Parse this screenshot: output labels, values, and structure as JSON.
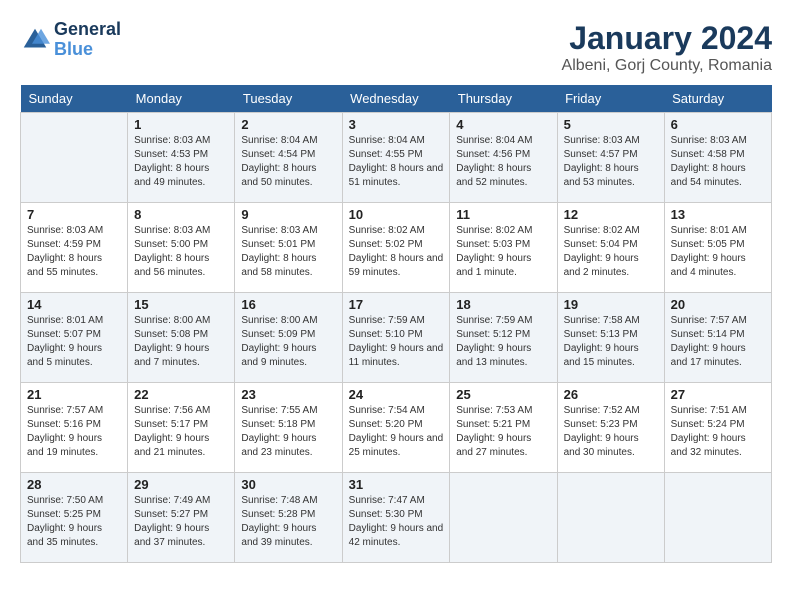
{
  "logo": {
    "line1": "General",
    "line2": "Blue"
  },
  "title": "January 2024",
  "subtitle": "Albeni, Gorj County, Romania",
  "weekdays": [
    "Sunday",
    "Monday",
    "Tuesday",
    "Wednesday",
    "Thursday",
    "Friday",
    "Saturday"
  ],
  "weeks": [
    [
      {
        "day": "",
        "sunrise": "",
        "sunset": "",
        "daylight": ""
      },
      {
        "day": "1",
        "sunrise": "Sunrise: 8:03 AM",
        "sunset": "Sunset: 4:53 PM",
        "daylight": "Daylight: 8 hours and 49 minutes."
      },
      {
        "day": "2",
        "sunrise": "Sunrise: 8:04 AM",
        "sunset": "Sunset: 4:54 PM",
        "daylight": "Daylight: 8 hours and 50 minutes."
      },
      {
        "day": "3",
        "sunrise": "Sunrise: 8:04 AM",
        "sunset": "Sunset: 4:55 PM",
        "daylight": "Daylight: 8 hours and 51 minutes."
      },
      {
        "day": "4",
        "sunrise": "Sunrise: 8:04 AM",
        "sunset": "Sunset: 4:56 PM",
        "daylight": "Daylight: 8 hours and 52 minutes."
      },
      {
        "day": "5",
        "sunrise": "Sunrise: 8:03 AM",
        "sunset": "Sunset: 4:57 PM",
        "daylight": "Daylight: 8 hours and 53 minutes."
      },
      {
        "day": "6",
        "sunrise": "Sunrise: 8:03 AM",
        "sunset": "Sunset: 4:58 PM",
        "daylight": "Daylight: 8 hours and 54 minutes."
      }
    ],
    [
      {
        "day": "7",
        "sunrise": "Sunrise: 8:03 AM",
        "sunset": "Sunset: 4:59 PM",
        "daylight": "Daylight: 8 hours and 55 minutes."
      },
      {
        "day": "8",
        "sunrise": "Sunrise: 8:03 AM",
        "sunset": "Sunset: 5:00 PM",
        "daylight": "Daylight: 8 hours and 56 minutes."
      },
      {
        "day": "9",
        "sunrise": "Sunrise: 8:03 AM",
        "sunset": "Sunset: 5:01 PM",
        "daylight": "Daylight: 8 hours and 58 minutes."
      },
      {
        "day": "10",
        "sunrise": "Sunrise: 8:02 AM",
        "sunset": "Sunset: 5:02 PM",
        "daylight": "Daylight: 8 hours and 59 minutes."
      },
      {
        "day": "11",
        "sunrise": "Sunrise: 8:02 AM",
        "sunset": "Sunset: 5:03 PM",
        "daylight": "Daylight: 9 hours and 1 minute."
      },
      {
        "day": "12",
        "sunrise": "Sunrise: 8:02 AM",
        "sunset": "Sunset: 5:04 PM",
        "daylight": "Daylight: 9 hours and 2 minutes."
      },
      {
        "day": "13",
        "sunrise": "Sunrise: 8:01 AM",
        "sunset": "Sunset: 5:05 PM",
        "daylight": "Daylight: 9 hours and 4 minutes."
      }
    ],
    [
      {
        "day": "14",
        "sunrise": "Sunrise: 8:01 AM",
        "sunset": "Sunset: 5:07 PM",
        "daylight": "Daylight: 9 hours and 5 minutes."
      },
      {
        "day": "15",
        "sunrise": "Sunrise: 8:00 AM",
        "sunset": "Sunset: 5:08 PM",
        "daylight": "Daylight: 9 hours and 7 minutes."
      },
      {
        "day": "16",
        "sunrise": "Sunrise: 8:00 AM",
        "sunset": "Sunset: 5:09 PM",
        "daylight": "Daylight: 9 hours and 9 minutes."
      },
      {
        "day": "17",
        "sunrise": "Sunrise: 7:59 AM",
        "sunset": "Sunset: 5:10 PM",
        "daylight": "Daylight: 9 hours and 11 minutes."
      },
      {
        "day": "18",
        "sunrise": "Sunrise: 7:59 AM",
        "sunset": "Sunset: 5:12 PM",
        "daylight": "Daylight: 9 hours and 13 minutes."
      },
      {
        "day": "19",
        "sunrise": "Sunrise: 7:58 AM",
        "sunset": "Sunset: 5:13 PM",
        "daylight": "Daylight: 9 hours and 15 minutes."
      },
      {
        "day": "20",
        "sunrise": "Sunrise: 7:57 AM",
        "sunset": "Sunset: 5:14 PM",
        "daylight": "Daylight: 9 hours and 17 minutes."
      }
    ],
    [
      {
        "day": "21",
        "sunrise": "Sunrise: 7:57 AM",
        "sunset": "Sunset: 5:16 PM",
        "daylight": "Daylight: 9 hours and 19 minutes."
      },
      {
        "day": "22",
        "sunrise": "Sunrise: 7:56 AM",
        "sunset": "Sunset: 5:17 PM",
        "daylight": "Daylight: 9 hours and 21 minutes."
      },
      {
        "day": "23",
        "sunrise": "Sunrise: 7:55 AM",
        "sunset": "Sunset: 5:18 PM",
        "daylight": "Daylight: 9 hours and 23 minutes."
      },
      {
        "day": "24",
        "sunrise": "Sunrise: 7:54 AM",
        "sunset": "Sunset: 5:20 PM",
        "daylight": "Daylight: 9 hours and 25 minutes."
      },
      {
        "day": "25",
        "sunrise": "Sunrise: 7:53 AM",
        "sunset": "Sunset: 5:21 PM",
        "daylight": "Daylight: 9 hours and 27 minutes."
      },
      {
        "day": "26",
        "sunrise": "Sunrise: 7:52 AM",
        "sunset": "Sunset: 5:23 PM",
        "daylight": "Daylight: 9 hours and 30 minutes."
      },
      {
        "day": "27",
        "sunrise": "Sunrise: 7:51 AM",
        "sunset": "Sunset: 5:24 PM",
        "daylight": "Daylight: 9 hours and 32 minutes."
      }
    ],
    [
      {
        "day": "28",
        "sunrise": "Sunrise: 7:50 AM",
        "sunset": "Sunset: 5:25 PM",
        "daylight": "Daylight: 9 hours and 35 minutes."
      },
      {
        "day": "29",
        "sunrise": "Sunrise: 7:49 AM",
        "sunset": "Sunset: 5:27 PM",
        "daylight": "Daylight: 9 hours and 37 minutes."
      },
      {
        "day": "30",
        "sunrise": "Sunrise: 7:48 AM",
        "sunset": "Sunset: 5:28 PM",
        "daylight": "Daylight: 9 hours and 39 minutes."
      },
      {
        "day": "31",
        "sunrise": "Sunrise: 7:47 AM",
        "sunset": "Sunset: 5:30 PM",
        "daylight": "Daylight: 9 hours and 42 minutes."
      },
      {
        "day": "",
        "sunrise": "",
        "sunset": "",
        "daylight": ""
      },
      {
        "day": "",
        "sunrise": "",
        "sunset": "",
        "daylight": ""
      },
      {
        "day": "",
        "sunrise": "",
        "sunset": "",
        "daylight": ""
      }
    ]
  ]
}
